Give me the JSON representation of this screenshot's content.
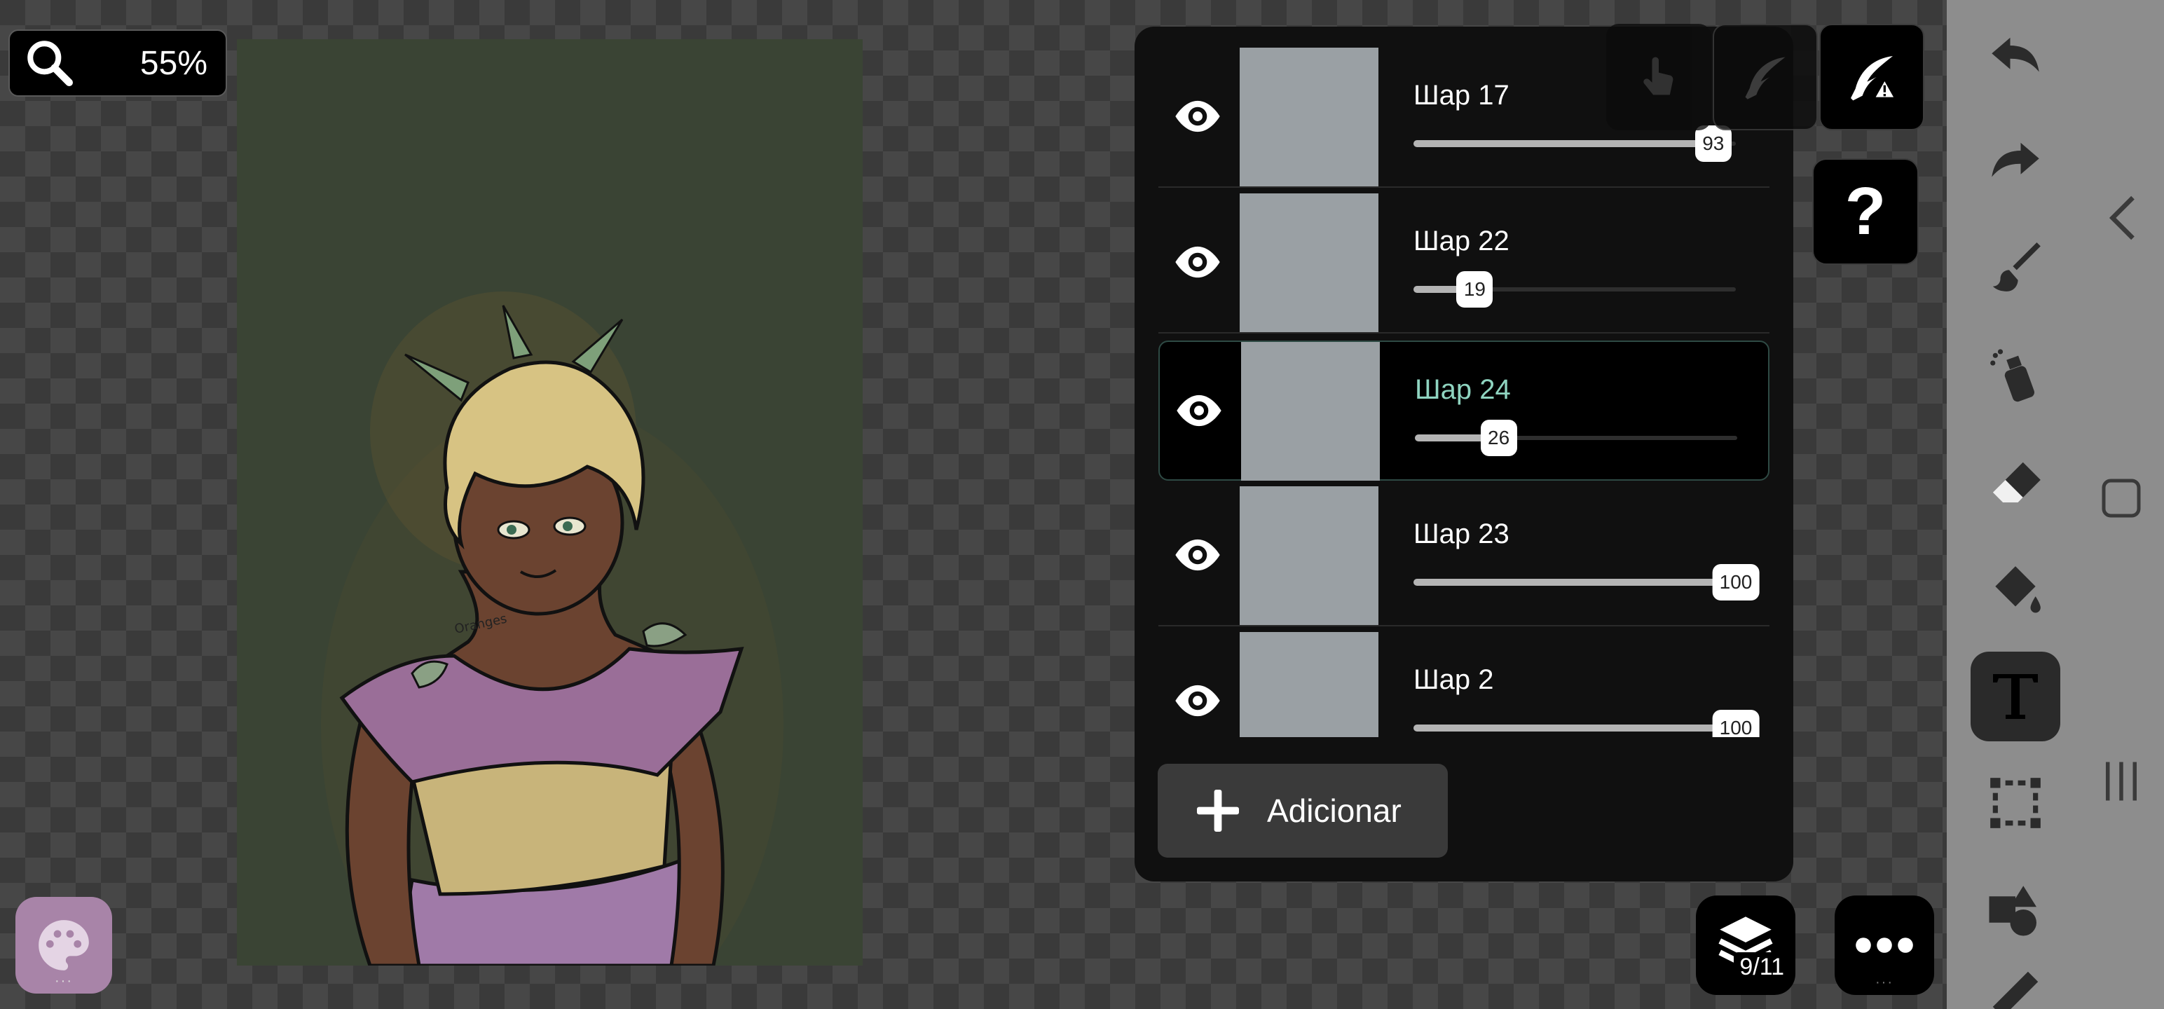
{
  "zoom": {
    "value": "55%",
    "icon": "magnifier-icon"
  },
  "canvas": {
    "background": "#3a4434",
    "signature": "Oranges"
  },
  "palette": {
    "icon": "palette-icon",
    "color": "#a884a8"
  },
  "layers_panel": {
    "layers": [
      {
        "name": "Шар 17",
        "opacity": 93,
        "visible": true,
        "selected": false
      },
      {
        "name": "Шар 22",
        "opacity": 19,
        "visible": true,
        "selected": false
      },
      {
        "name": "Шар 24",
        "opacity": 26,
        "visible": true,
        "selected": true
      },
      {
        "name": "Шар 23",
        "opacity": 100,
        "visible": true,
        "selected": false
      },
      {
        "name": "Шар 2",
        "opacity": 100,
        "visible": true,
        "selected": false
      }
    ],
    "add_label": "Adicionar"
  },
  "mode_buttons": [
    "touch-hand-icon",
    "pen-quill-icon",
    "pen-quill-warning-icon"
  ],
  "help_label": "?",
  "layers_button": {
    "count": "9/11",
    "icon": "layers-stack-icon"
  },
  "more_button": {
    "icon": "more-dots-icon"
  },
  "toolbar": {
    "tools": [
      "undo-icon",
      "redo-icon",
      "brush-icon",
      "spray-icon",
      "eraser-icon",
      "fill-bucket-icon",
      "text-icon",
      "selection-icon",
      "shapes-icon",
      "ruler-icon"
    ],
    "active": "text-icon"
  },
  "system_nav": [
    "back-chevron-icon",
    "home-square-icon",
    "recents-icon"
  ]
}
